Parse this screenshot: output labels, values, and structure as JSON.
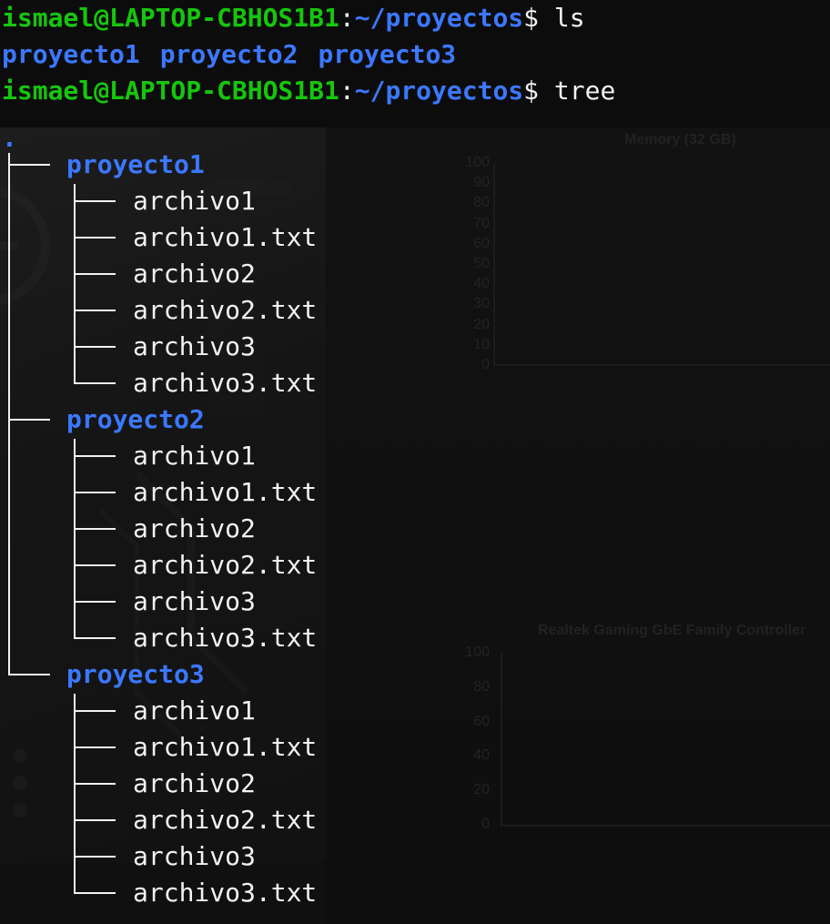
{
  "prompt1": {
    "user": "ismael@LAPTOP-CBHOS1B1",
    "sep": ":",
    "path": "~/proyectos",
    "symbol": "$",
    "command": "ls"
  },
  "ls_output": [
    "proyecto1",
    "proyecto2",
    "proyecto3"
  ],
  "prompt2": {
    "user": "ismael@LAPTOP-CBHOS1B1",
    "sep": ":",
    "path": "~/proyectos",
    "symbol": "$",
    "command": "tree"
  },
  "tree": {
    "root": ".",
    "dirs": [
      {
        "name": "proyecto1",
        "files": [
          "archivo1",
          "archivo1.txt",
          "archivo2",
          "archivo2.txt",
          "archivo3",
          "archivo3.txt"
        ]
      },
      {
        "name": "proyecto2",
        "files": [
          "archivo1",
          "archivo1.txt",
          "archivo2",
          "archivo2.txt",
          "archivo3",
          "archivo3.txt"
        ]
      },
      {
        "name": "proyecto3",
        "files": [
          "archivo1",
          "archivo1.txt",
          "archivo2",
          "archivo2.txt",
          "archivo3",
          "archivo3.txt"
        ]
      }
    ]
  },
  "background": {
    "chart1_title": "Memory (32 GB)",
    "chart1_ticks": [
      "100",
      "90",
      "80",
      "70",
      "60",
      "50",
      "40",
      "30",
      "20",
      "10",
      "0"
    ],
    "chart2_title": "Realtek Gaming GbE Family Controller",
    "chart2_ticks": [
      "100",
      "80",
      "60",
      "40",
      "20",
      "0"
    ]
  },
  "colors": {
    "green": "#16c60c",
    "blue": "#3b78ff",
    "text": "#f2f2f2",
    "bg": "#0c0c0c"
  }
}
